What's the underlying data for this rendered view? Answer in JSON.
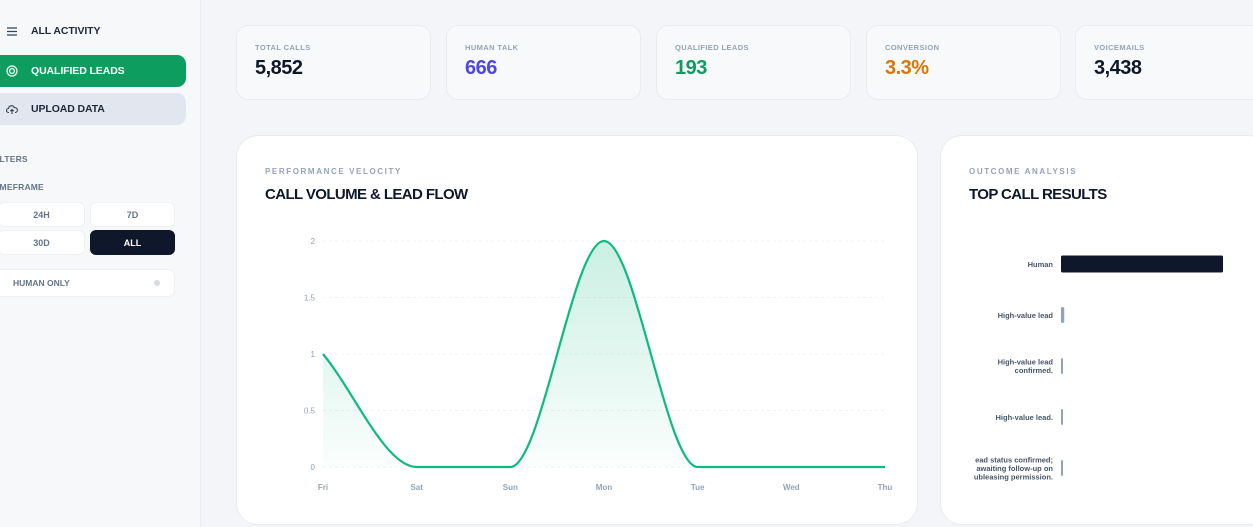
{
  "sidebar": {
    "nav": [
      {
        "label": "ALL ACTIVITY",
        "icon": "menu-icon"
      },
      {
        "label": "QUALIFIED LEADS",
        "icon": "target-icon"
      },
      {
        "label": "UPLOAD DATA",
        "icon": "upload-cloud-icon"
      }
    ],
    "filters_heading": "ILTERS",
    "timeframe_heading": "IMEFRAME",
    "timeframes": [
      "24H",
      "7D",
      "30D",
      "ALL"
    ],
    "active_timeframe": "ALL",
    "toggle_label": "HUMAN ONLY"
  },
  "stats": [
    {
      "label": "TOTAL CALLS",
      "value": "5,852",
      "color": "#0f172a"
    },
    {
      "label": "HUMAN TALK",
      "value": "666",
      "color": "#4f46e5"
    },
    {
      "label": "QUALIFIED LEADS",
      "value": "193",
      "color": "#0d9e5f"
    },
    {
      "label": "CONVERSION",
      "value": "3.3%",
      "color": "#d97706"
    },
    {
      "label": "VOICEMAILS",
      "value": "3,438",
      "color": "#0f172a"
    }
  ],
  "velocity_panel": {
    "kicker": "PERFORMANCE VELOCITY",
    "title": "CALL VOLUME & LEAD FLOW"
  },
  "outcome_panel": {
    "kicker": "OUTCOME ANALYSIS",
    "title": "TOP CALL RESULTS"
  },
  "chart_data": [
    {
      "type": "area",
      "categories": [
        "Fri",
        "Sat",
        "Sun",
        "Mon",
        "Tue",
        "Wed",
        "Thu"
      ],
      "values": [
        1,
        0,
        0,
        2,
        0,
        0,
        0
      ],
      "yticks": [
        "0",
        "0.5",
        "1",
        "1.5",
        "2"
      ],
      "ylim": [
        0,
        2
      ],
      "grid": true,
      "line_color": "#10b981"
    },
    {
      "type": "bar",
      "orientation": "horizontal",
      "categories": [
        "Human",
        "High-value lead",
        "High-value lead confirmed.",
        "High-value lead.",
        "ead status confirmed; awaiting follow-up on ubleasing permission."
      ],
      "category_lines": [
        [
          "Human"
        ],
        [
          "High-value lead"
        ],
        [
          "High-value lead",
          "confirmed."
        ],
        [
          "High-value lead."
        ],
        [
          "ead status confirmed;",
          "awaiting follow-up on",
          "ubleasing permission."
        ]
      ],
      "values": [
        100,
        2,
        1,
        1,
        1
      ],
      "bar_colors": [
        "#0f172a",
        "#94a3b8",
        "#94a3b8",
        "#94a3b8",
        "#94a3b8"
      ]
    }
  ]
}
